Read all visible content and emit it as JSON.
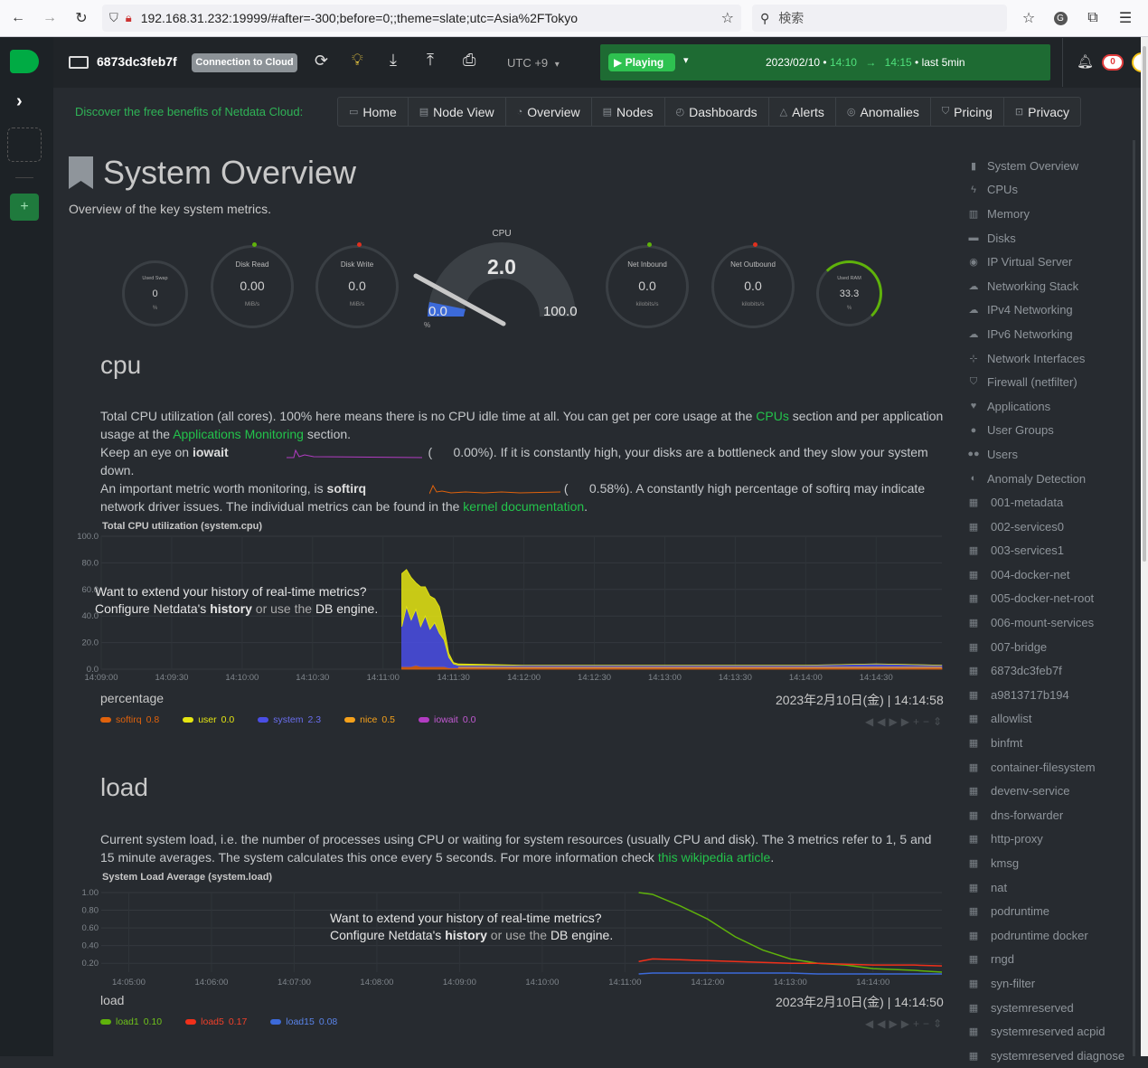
{
  "browser": {
    "url": "192.168.31.232:19999/#after=-300;before=0;;theme=slate;utc=Asia%2FTokyo",
    "search_placeholder": "検索"
  },
  "topbar": {
    "node_name": "6873dc3feb7f",
    "connection_label": "Connection to Cloud",
    "timezone": "UTC +9",
    "play_label": "Playing",
    "date": "2023/02/10",
    "time_from": "14:10",
    "time_to": "14:15",
    "range": "last 5min",
    "alerts_count": "0"
  },
  "promo": "Discover the free benefits of Netdata Cloud:",
  "nav": [
    {
      "label": "Home",
      "icon": "desktop-icon"
    },
    {
      "label": "Node View",
      "icon": "server-icon"
    },
    {
      "label": "Overview",
      "icon": "overview-icon"
    },
    {
      "label": "Nodes",
      "icon": "nodes-icon"
    },
    {
      "label": "Dashboards",
      "icon": "dashboard-icon"
    },
    {
      "label": "Alerts",
      "icon": "bell-icon"
    },
    {
      "label": "Anomalies",
      "icon": "anomalies-icon"
    },
    {
      "label": "Pricing",
      "icon": "shield-icon"
    },
    {
      "label": "Privacy",
      "icon": "lock-icon"
    }
  ],
  "page": {
    "title": "System Overview",
    "subtitle": "Overview of the key system metrics."
  },
  "gauges": {
    "swap": {
      "title": "Used Swap",
      "value": "0",
      "unit": "%"
    },
    "disk_read": {
      "title": "Disk Read",
      "value": "0.00",
      "unit": "MiB/s"
    },
    "disk_write": {
      "title": "Disk Write",
      "value": "0.0",
      "unit": "MiB/s"
    },
    "cpu": {
      "title": "CPU",
      "value": "2.0",
      "min": "0.0",
      "max": "100.0",
      "unit": "%"
    },
    "net_in": {
      "title": "Net Inbound",
      "value": "0.0",
      "unit": "kilobits/s"
    },
    "net_out": {
      "title": "Net Outbound",
      "value": "0.0",
      "unit": "kilobits/s"
    },
    "ram": {
      "title": "Used RAM",
      "value": "33.3",
      "unit": "%"
    }
  },
  "cpu_section": {
    "heading": "cpu",
    "p1a": "Total CPU utilization (all cores). 100% here means there is no CPU idle time at all. You can get per core usage at the ",
    "p1_link1": "CPUs",
    "p1b": " section and per application usage at the ",
    "p1_link2": "Applications Monitoring",
    "p1c": " section.",
    "p2a": "Keep an eye on ",
    "p2_bold": "iowait",
    "p2_val": "0.00%). If it is constantly high, your disks are a bottleneck and they slow your system down.",
    "p3a": "An important metric worth monitoring, is ",
    "p3_bold": "softirq",
    "p3_val": "0.58%). A constantly high percentage of softirq may indicate network driver issues. The individual metrics can be found in the ",
    "p3_link": "kernel documentation",
    "chart_title": "Total CPU utilization (system.cpu)",
    "unit": "percentage",
    "timestamp": "2023年2月10日(金) | 14:14:58",
    "overlay1": "Want to extend your history of real-time metrics?",
    "overlay2a": "Configure Netdata's ",
    "overlay2b": "history",
    "overlay2c": " or use the ",
    "overlay2d": "DB engine",
    "legend": [
      {
        "name": "softirq",
        "value": "0.8",
        "color": "#e0620c"
      },
      {
        "name": "user",
        "value": "0.0",
        "color": "#e5e512"
      },
      {
        "name": "system",
        "value": "2.3",
        "color": "#4a4ee5"
      },
      {
        "name": "nice",
        "value": "0.5",
        "color": "#f5a11b"
      },
      {
        "name": "iowait",
        "value": "0.0",
        "color": "#b23cc2"
      }
    ]
  },
  "load_section": {
    "heading": "load",
    "p1a": "Current system load, i.e. the number of processes using CPU or waiting for system resources (usually CPU and disk). The 3 metrics refer to 1, 5 and 15 minute averages. The system calculates this once every 5 seconds. For more information check ",
    "p1_link": "this wikipedia article",
    "chart_title": "System Load Average (system.load)",
    "unit": "load",
    "timestamp": "2023年2月10日(金) | 14:14:50",
    "legend": [
      {
        "name": "load1",
        "value": "0.10",
        "color": "#5fb20b"
      },
      {
        "name": "load5",
        "value": "0.17",
        "color": "#f0301a"
      },
      {
        "name": "load15",
        "value": "0.08",
        "color": "#3c6ad9"
      }
    ]
  },
  "sidebar": [
    {
      "label": "System Overview",
      "icon": "bookmark-icon"
    },
    {
      "label": "CPUs",
      "icon": "bolt-icon"
    },
    {
      "label": "Memory",
      "icon": "memory-icon"
    },
    {
      "label": "Disks",
      "icon": "disk-icon"
    },
    {
      "label": "IP Virtual Server",
      "icon": "eye-icon"
    },
    {
      "label": "Networking Stack",
      "icon": "cloud-icon"
    },
    {
      "label": "IPv4 Networking",
      "icon": "cloud-icon"
    },
    {
      "label": "IPv6 Networking",
      "icon": "cloud-icon"
    },
    {
      "label": "Network Interfaces",
      "icon": "sitemap-icon"
    },
    {
      "label": "Firewall (netfilter)",
      "icon": "shield-icon"
    },
    {
      "label": "Applications",
      "icon": "heartbeat-icon"
    },
    {
      "label": "User Groups",
      "icon": "user-icon"
    },
    {
      "label": "Users",
      "icon": "users-icon"
    },
    {
      "label": "Anomaly Detection",
      "icon": "anomaly-icon"
    },
    {
      "label": "001-metadata",
      "icon": "grid-icon"
    },
    {
      "label": "002-services0",
      "icon": "grid-icon"
    },
    {
      "label": "003-services1",
      "icon": "grid-icon"
    },
    {
      "label": "004-docker-net",
      "icon": "grid-icon"
    },
    {
      "label": "005-docker-net-root",
      "icon": "grid-icon"
    },
    {
      "label": "006-mount-services",
      "icon": "grid-icon"
    },
    {
      "label": "007-bridge",
      "icon": "grid-icon"
    },
    {
      "label": "6873dc3feb7f",
      "icon": "grid-icon"
    },
    {
      "label": "a9813717b194",
      "icon": "grid-icon"
    },
    {
      "label": "allowlist",
      "icon": "grid-icon"
    },
    {
      "label": "binfmt",
      "icon": "grid-icon"
    },
    {
      "label": "container-filesystem",
      "icon": "grid-icon"
    },
    {
      "label": "devenv-service",
      "icon": "grid-icon"
    },
    {
      "label": "dns-forwarder",
      "icon": "grid-icon"
    },
    {
      "label": "http-proxy",
      "icon": "grid-icon"
    },
    {
      "label": "kmsg",
      "icon": "grid-icon"
    },
    {
      "label": "nat",
      "icon": "grid-icon"
    },
    {
      "label": "podruntime",
      "icon": "grid-icon"
    },
    {
      "label": "podruntime docker",
      "icon": "grid-icon"
    },
    {
      "label": "rngd",
      "icon": "grid-icon"
    },
    {
      "label": "syn-filter",
      "icon": "grid-icon"
    },
    {
      "label": "systemreserved",
      "icon": "grid-icon"
    },
    {
      "label": "systemreserved acpid",
      "icon": "grid-icon"
    },
    {
      "label": "systemreserved diagnose",
      "icon": "grid-icon"
    }
  ],
  "chart_data": [
    {
      "type": "area",
      "title": "Total CPU utilization (system.cpu)",
      "ylabel": "percentage",
      "ylim": [
        0,
        100
      ],
      "yticks": [
        "100.0",
        "80.0",
        "60.0",
        "40.0",
        "20.0",
        "0.0"
      ],
      "xticks": [
        "14:09:00",
        "14:09:30",
        "14:10:00",
        "14:10:30",
        "14:11:00",
        "14:11:30",
        "14:12:00",
        "14:12:30",
        "14:13:00",
        "14:13:30",
        "14:14:00",
        "14:14:30"
      ],
      "x": [
        "14:11:08",
        "14:11:10",
        "14:11:12",
        "14:11:14",
        "14:11:16",
        "14:11:18",
        "14:11:20",
        "14:11:22",
        "14:11:24",
        "14:11:26",
        "14:11:28",
        "14:11:30",
        "14:11:32",
        "14:12:00",
        "14:13:00",
        "14:14:00",
        "14:14:30",
        "14:14:58"
      ],
      "series": [
        {
          "name": "system",
          "values": [
            30,
            45,
            35,
            42,
            30,
            38,
            28,
            33,
            25,
            20,
            8,
            3,
            2,
            2,
            2,
            2,
            3,
            2
          ]
        },
        {
          "name": "user",
          "values": [
            40,
            28,
            32,
            20,
            30,
            22,
            25,
            18,
            20,
            10,
            3,
            1,
            1,
            0,
            0,
            0,
            0,
            0
          ]
        },
        {
          "name": "softirq",
          "values": [
            2,
            2,
            2,
            3,
            2,
            2,
            2,
            2,
            2,
            2,
            1,
            1,
            1,
            1,
            1,
            1,
            1,
            1
          ]
        }
      ]
    },
    {
      "type": "line",
      "title": "System Load Average (system.load)",
      "ylabel": "load",
      "yticks": [
        "1.00",
        "0.80",
        "0.60",
        "0.40",
        "0.20"
      ],
      "xticks": [
        "14:05:00",
        "14:06:00",
        "14:07:00",
        "14:08:00",
        "14:09:00",
        "14:10:00",
        "14:11:00",
        "14:12:00",
        "14:13:00",
        "14:14:00"
      ],
      "x": [
        "14:11:10",
        "14:11:20",
        "14:11:40",
        "14:12:00",
        "14:12:20",
        "14:12:40",
        "14:13:00",
        "14:13:20",
        "14:13:40",
        "14:14:00",
        "14:14:30",
        "14:14:50"
      ],
      "series": [
        {
          "name": "load1",
          "values": [
            1.0,
            0.98,
            0.85,
            0.7,
            0.5,
            0.35,
            0.25,
            0.2,
            0.18,
            0.14,
            0.12,
            0.1
          ]
        },
        {
          "name": "load5",
          "values": [
            0.22,
            0.25,
            0.24,
            0.23,
            0.22,
            0.21,
            0.2,
            0.2,
            0.19,
            0.18,
            0.18,
            0.17
          ]
        },
        {
          "name": "load15",
          "values": [
            0.08,
            0.09,
            0.09,
            0.09,
            0.09,
            0.09,
            0.09,
            0.08,
            0.08,
            0.08,
            0.08,
            0.08
          ]
        }
      ]
    }
  ]
}
